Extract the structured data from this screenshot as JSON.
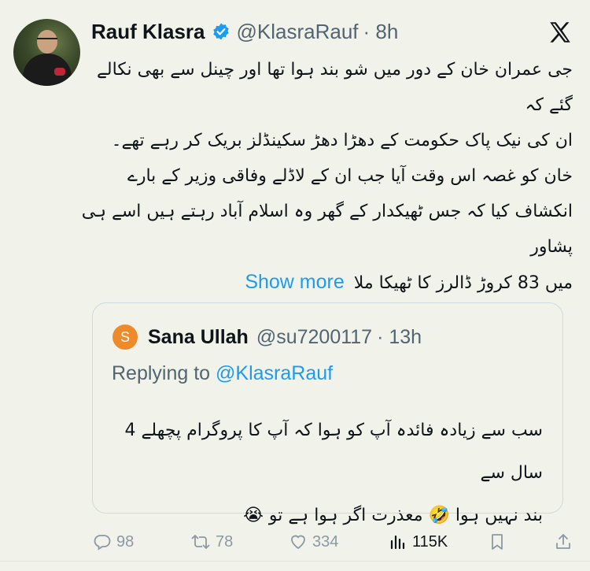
{
  "tweet": {
    "author_name": "Rauf Klasra",
    "handle": "@KlasraRauf",
    "time": "· 8h",
    "body_lines": [
      "جی عمران خان کے دور میں شو بند ہوا تھا اور چینل سے بھی نکالے گئے کہ",
      "ان کی نیک پاک حکومت کے دھڑا دھڑ سکینڈلز بریک کر رہے تھے۔",
      "خان کو غصہ اس وقت آیا جب ان کے لاڈلے وفاقی وزیر کے بارے",
      "انکشاف کیا کہ جس ٹھیکدار کے گھر وہ اسلام آباد رہتے ہیں اسے ہی پشاور",
      "میں 83 کروڑ ڈالرز کا ٹھیکا ملا"
    ],
    "show_more": "Show more"
  },
  "quoted": {
    "avatar_letter": "S",
    "author_name": "Sana Ullah",
    "handle": "@su7200117",
    "time": "· 13h",
    "replying_prefix": "Replying to",
    "replying_to": "@KlasraRauf",
    "body_lines": [
      "سب سے زیادہ فائدہ آپ کو ہوا کہ آپ کا پروگرام پچھلے 4 سال سے",
      "بند نہیں ہوا 🤣 معذرت اگر ہوا ہے تو 😭"
    ]
  },
  "actions": {
    "replies": "98",
    "retweets": "78",
    "likes": "334",
    "views": "115K"
  },
  "colors": {
    "background": "#f1f3eb",
    "link": "#1d9bf0",
    "verified": "#1d9bf0",
    "muted": "#536471",
    "quote_avatar": "#ef8a2a"
  }
}
